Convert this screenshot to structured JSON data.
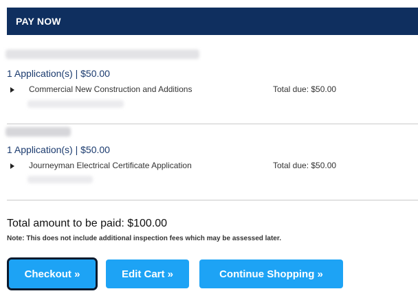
{
  "header": {
    "title": "PAY NOW"
  },
  "groups": [
    {
      "summary": "1 Application(s) | $50.00",
      "record_name": "Commercial New Construction and Additions",
      "total_due": "Total due: $50.00"
    },
    {
      "summary": "1 Application(s) | $50.00",
      "record_name": "Journeyman Electrical Certificate Application",
      "total_due": "Total due: $50.00"
    }
  ],
  "totals": {
    "amount_text": "Total amount to be paid: $100.00",
    "note": "Note: This does not include additional inspection fees which may be assessed later."
  },
  "actions": {
    "checkout_label": "Checkout »",
    "edit_cart_label": "Edit Cart »",
    "continue_shopping_label": "Continue Shopping »"
  },
  "colors": {
    "header_bg": "#0f2f5f",
    "button_bg": "#1da3f5",
    "link_blue": "#1a3a6e"
  }
}
